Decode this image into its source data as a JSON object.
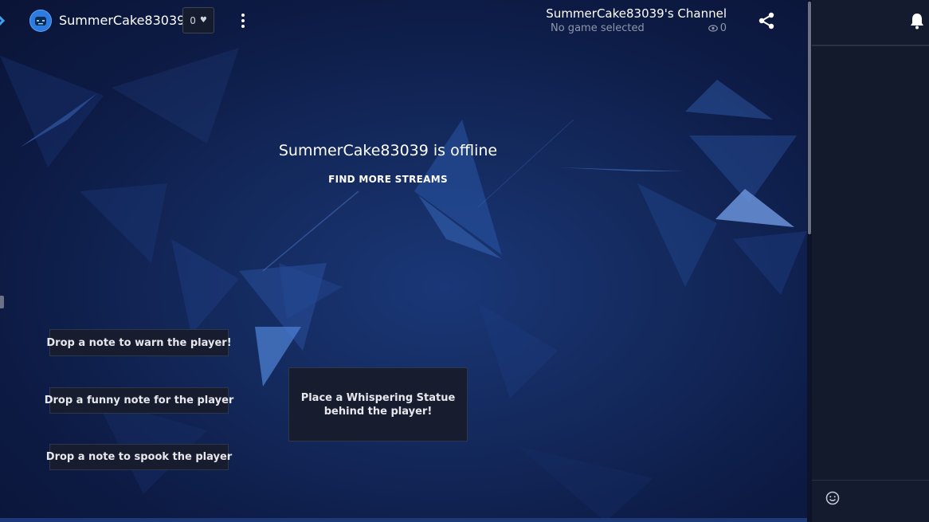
{
  "header": {
    "streamer_name": "SummerCake83039",
    "follow_count": "0",
    "channel_title": "SummerCake83039's Channel",
    "game_status": "No game selected",
    "viewer_count": "0"
  },
  "stage": {
    "offline_message": "SummerCake83039 is offline",
    "find_more_label": "FIND MORE STREAMS"
  },
  "interactive_buttons": {
    "warn": "Drop a note to warn the player!",
    "funny": "Drop a funny note for the player",
    "spook": "Drop a note to spook the player",
    "statue": "Place a Whispering Statue behind the player!"
  },
  "icons": {
    "brand": "chevron-logo-icon",
    "avatar": "robot-avatar-icon",
    "heart": "heart-icon",
    "more": "kebab-menu-icon",
    "viewers": "eye-icon",
    "share": "share-icon",
    "notifications": "bell-icon",
    "emoji": "smiley-icon"
  },
  "colors": {
    "accent": "#2c7be0",
    "stage_background": "#142a5e",
    "chat_background": "#141a2c",
    "muted_text": "#8e97ab"
  }
}
